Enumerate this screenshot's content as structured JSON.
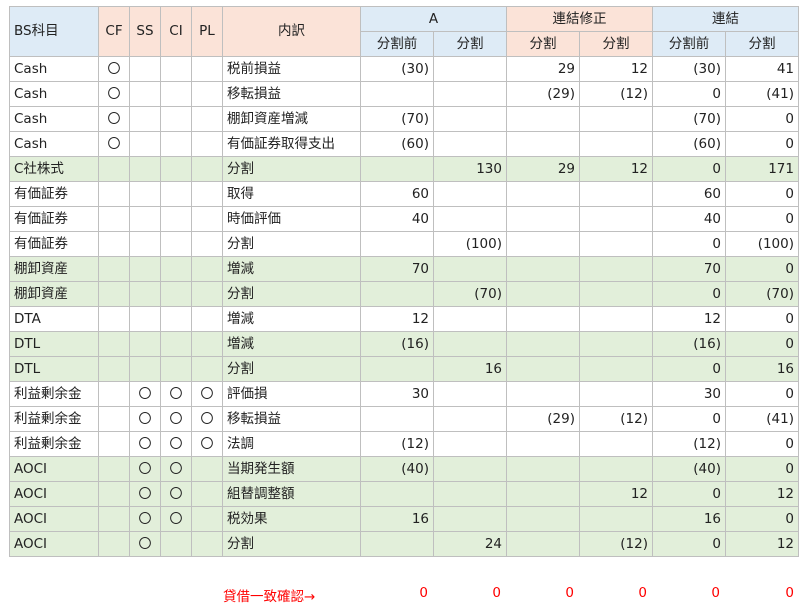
{
  "header": {
    "bs_item": "BS科目",
    "cf": "CF",
    "ss": "SS",
    "ci": "CI",
    "pl": "PL",
    "breakdown": "内訳",
    "groups": [
      "A",
      "連結修正",
      "連結"
    ],
    "sub_before": "分割前",
    "sub_split": "分割"
  },
  "rows": [
    {
      "item": "Cash",
      "cf": "〇",
      "ss": "",
      "ci": "",
      "pl": "",
      "desc": "税前損益",
      "a_before": "(30)",
      "a_split": "",
      "adj_before": "29",
      "adj_split": "12",
      "con_before": "(30)",
      "con_split": "41",
      "highlight": false
    },
    {
      "item": "Cash",
      "cf": "〇",
      "ss": "",
      "ci": "",
      "pl": "",
      "desc": "移転損益",
      "a_before": "",
      "a_split": "",
      "adj_before": "(29)",
      "adj_split": "(12)",
      "con_before": "0",
      "con_split": "(41)",
      "highlight": false
    },
    {
      "item": "Cash",
      "cf": "〇",
      "ss": "",
      "ci": "",
      "pl": "",
      "desc": "棚卸資産増減",
      "a_before": "(70)",
      "a_split": "",
      "adj_before": "",
      "adj_split": "",
      "con_before": "(70)",
      "con_split": "0",
      "highlight": false
    },
    {
      "item": "Cash",
      "cf": "〇",
      "ss": "",
      "ci": "",
      "pl": "",
      "desc": "有価証券取得支出",
      "a_before": "(60)",
      "a_split": "",
      "adj_before": "",
      "adj_split": "",
      "con_before": "(60)",
      "con_split": "0",
      "highlight": false
    },
    {
      "item": "C社株式",
      "cf": "",
      "ss": "",
      "ci": "",
      "pl": "",
      "desc": "分割",
      "a_before": "",
      "a_split": "130",
      "adj_before": "29",
      "adj_split": "12",
      "con_before": "0",
      "con_split": "171",
      "highlight": true
    },
    {
      "item": "有価証券",
      "cf": "",
      "ss": "",
      "ci": "",
      "pl": "",
      "desc": "取得",
      "a_before": "60",
      "a_split": "",
      "adj_before": "",
      "adj_split": "",
      "con_before": "60",
      "con_split": "0",
      "highlight": false
    },
    {
      "item": "有価証券",
      "cf": "",
      "ss": "",
      "ci": "",
      "pl": "",
      "desc": "時価評価",
      "a_before": "40",
      "a_split": "",
      "adj_before": "",
      "adj_split": "",
      "con_before": "40",
      "con_split": "0",
      "highlight": false
    },
    {
      "item": "有価証券",
      "cf": "",
      "ss": "",
      "ci": "",
      "pl": "",
      "desc": "分割",
      "a_before": "",
      "a_split": "(100)",
      "adj_before": "",
      "adj_split": "",
      "con_before": "0",
      "con_split": "(100)",
      "highlight": false
    },
    {
      "item": "棚卸資産",
      "cf": "",
      "ss": "",
      "ci": "",
      "pl": "",
      "desc": "増減",
      "a_before": "70",
      "a_split": "",
      "adj_before": "",
      "adj_split": "",
      "con_before": "70",
      "con_split": "0",
      "highlight": true
    },
    {
      "item": "棚卸資産",
      "cf": "",
      "ss": "",
      "ci": "",
      "pl": "",
      "desc": "分割",
      "a_before": "",
      "a_split": "(70)",
      "adj_before": "",
      "adj_split": "",
      "con_before": "0",
      "con_split": "(70)",
      "highlight": true
    },
    {
      "item": "DTA",
      "cf": "",
      "ss": "",
      "ci": "",
      "pl": "",
      "desc": "増減",
      "a_before": "12",
      "a_split": "",
      "adj_before": "",
      "adj_split": "",
      "con_before": "12",
      "con_split": "0",
      "highlight": false
    },
    {
      "item": "DTL",
      "cf": "",
      "ss": "",
      "ci": "",
      "pl": "",
      "desc": "増減",
      "a_before": "(16)",
      "a_split": "",
      "adj_before": "",
      "adj_split": "",
      "con_before": "(16)",
      "con_split": "0",
      "highlight": true
    },
    {
      "item": "DTL",
      "cf": "",
      "ss": "",
      "ci": "",
      "pl": "",
      "desc": "分割",
      "a_before": "",
      "a_split": "16",
      "adj_before": "",
      "adj_split": "",
      "con_before": "0",
      "con_split": "16",
      "highlight": true
    },
    {
      "item": "利益剰余金",
      "cf": "",
      "ss": "〇",
      "ci": "〇",
      "pl": "〇",
      "desc": "評価損",
      "a_before": "30",
      "a_split": "",
      "adj_before": "",
      "adj_split": "",
      "con_before": "30",
      "con_split": "0",
      "highlight": false
    },
    {
      "item": "利益剰余金",
      "cf": "",
      "ss": "〇",
      "ci": "〇",
      "pl": "〇",
      "desc": "移転損益",
      "a_before": "",
      "a_split": "",
      "adj_before": "(29)",
      "adj_split": "(12)",
      "con_before": "0",
      "con_split": "(41)",
      "highlight": false
    },
    {
      "item": "利益剰余金",
      "cf": "",
      "ss": "〇",
      "ci": "〇",
      "pl": "〇",
      "desc": "法調",
      "a_before": "(12)",
      "a_split": "",
      "adj_before": "",
      "adj_split": "",
      "con_before": "(12)",
      "con_split": "0",
      "highlight": false
    },
    {
      "item": "AOCI",
      "cf": "",
      "ss": "〇",
      "ci": "〇",
      "pl": "",
      "desc": "当期発生額",
      "a_before": "(40)",
      "a_split": "",
      "adj_before": "",
      "adj_split": "",
      "con_before": "(40)",
      "con_split": "0",
      "highlight": true
    },
    {
      "item": "AOCI",
      "cf": "",
      "ss": "〇",
      "ci": "〇",
      "pl": "",
      "desc": "組替調整額",
      "a_before": "",
      "a_split": "",
      "adj_before": "",
      "adj_split": "12",
      "con_before": "0",
      "con_split": "12",
      "highlight": true
    },
    {
      "item": "AOCI",
      "cf": "",
      "ss": "〇",
      "ci": "〇",
      "pl": "",
      "desc": "税効果",
      "a_before": "16",
      "a_split": "",
      "adj_before": "",
      "adj_split": "",
      "con_before": "16",
      "con_split": "0",
      "highlight": true
    },
    {
      "item": "AOCI",
      "cf": "",
      "ss": "〇",
      "ci": "",
      "pl": "",
      "desc": "分割",
      "a_before": "",
      "a_split": "24",
      "adj_before": "",
      "adj_split": "(12)",
      "con_before": "0",
      "con_split": "12",
      "highlight": true
    }
  ],
  "footer": {
    "label": "貸借一致確認→",
    "values": [
      "0",
      "0",
      "0",
      "0",
      "0",
      "0"
    ]
  },
  "colors": {
    "header_salmon": "#fbe3d8",
    "header_blue": "#deebf6",
    "highlight_green": "#e2efda",
    "footer_text": "#ff0000",
    "grid_line": "#bfbfbf"
  }
}
